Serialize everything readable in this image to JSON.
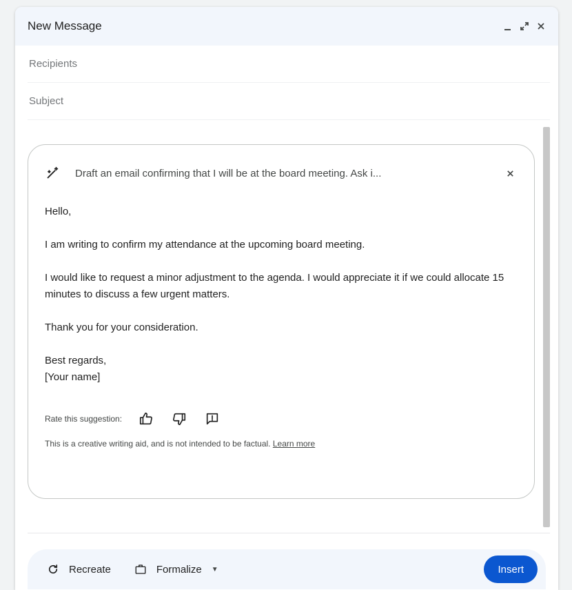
{
  "window": {
    "title": "New Message",
    "controls": [
      "minimize-icon",
      "expand-icon",
      "close-icon"
    ]
  },
  "fields": {
    "recipients_placeholder": "Recipients",
    "subject_placeholder": "Subject"
  },
  "card": {
    "prompt": "Draft an email confirming that I will be at the board meeting. Ask i...",
    "icon": "magic-wand-icon",
    "draft": {
      "greeting": "Hello,",
      "p1": "I am writing to confirm my attendance at the upcoming board meeting.",
      "p2": "I would like to request a minor adjustment to the agenda. I would appreciate it if we could allocate 15 minutes to discuss a few urgent matters.",
      "p3": "Thank you for your consideration.",
      "signoff": "Best regards,",
      "name": "[Your name]"
    },
    "rate_label": "Rate this suggestion:",
    "rate_icons": [
      "thumbs-up-icon",
      "thumbs-down-icon",
      "report-icon"
    ],
    "disclaimer": "This is a creative writing aid, and is not intended to be factual.",
    "learn_more": "Learn more"
  },
  "footer": {
    "recreate_label": "Recreate",
    "formalize_label": "Formalize",
    "insert_label": "Insert"
  },
  "colors": {
    "accent": "#0b57d0",
    "header_bg": "#f2f6fc",
    "card_border": "#c4c7c5"
  }
}
